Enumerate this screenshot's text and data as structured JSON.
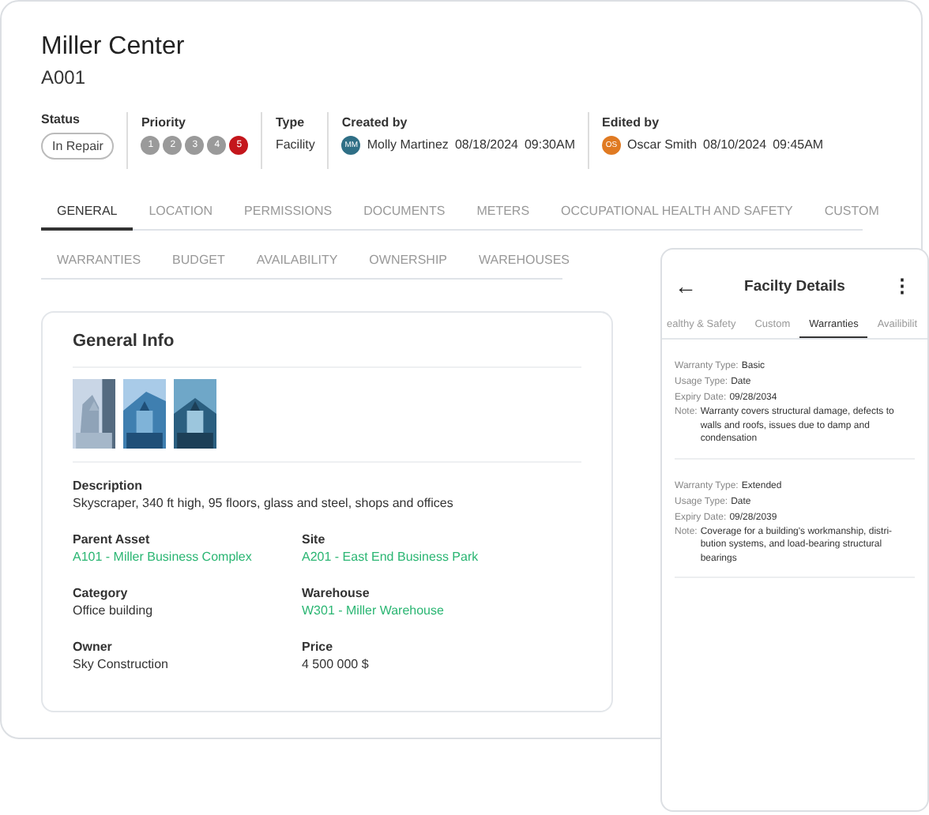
{
  "asset": {
    "title": "Miller Center",
    "code": "A001"
  },
  "meta": {
    "status": {
      "label": "Status",
      "value": "In Repair"
    },
    "priority": {
      "label": "Priority",
      "levels": [
        {
          "text": "1",
          "selected": false
        },
        {
          "text": "2",
          "selected": false
        },
        {
          "text": "3",
          "selected": false
        },
        {
          "text": "4",
          "selected": false
        },
        {
          "text": "5",
          "selected": true
        }
      ]
    },
    "type": {
      "label": "Type",
      "value": "Facility"
    },
    "created": {
      "label": "Created by",
      "initials": "MM",
      "color": "#2f6f86",
      "name": "Molly Martinez",
      "date": "08/18/2024",
      "time": "09:30AM"
    },
    "edited": {
      "label": "Edited by",
      "initials": "OS",
      "color": "#e07a22",
      "name": "Oscar Smith",
      "date": "08/10/2024",
      "time": "09:45AM"
    }
  },
  "tab_rows": [
    [
      {
        "label": "GENERAL",
        "selected": true
      },
      {
        "label": "LOCATION",
        "selected": false
      },
      {
        "label": "PERMISSIONS",
        "selected": false
      },
      {
        "label": "DOCUMENTS",
        "selected": false
      },
      {
        "label": "METERS",
        "selected": false
      },
      {
        "label": "OCCUPATIONAL HEALTH AND SAFETY",
        "selected": false
      },
      {
        "label": "CUSTOM",
        "selected": false
      }
    ],
    [
      {
        "label": "WARRANTIES",
        "selected": false
      },
      {
        "label": "BUDGET",
        "selected": false
      },
      {
        "label": "AVAILABILITY",
        "selected": false
      },
      {
        "label": "OWNERSHIP",
        "selected": false
      },
      {
        "label": "WAREHOUSES",
        "selected": false
      }
    ]
  ],
  "general_info": {
    "title": "General Info",
    "description": {
      "label": "Description",
      "value": "Skyscraper, 340 ft high, 95 floors, glass and steel, shops and offices"
    },
    "fields": [
      {
        "label": "Parent Asset",
        "value": "A101 - Miller Business Complex",
        "kind": "link"
      },
      {
        "label": "Site",
        "value": "A201 - East End Business Park",
        "kind": "link"
      },
      {
        "label": "Category",
        "value": "Office building",
        "kind": "text"
      },
      {
        "label": "Warehouse",
        "value": "W301 - Miller Warehouse",
        "kind": "link"
      },
      {
        "label": "Owner",
        "value": "Sky Construction",
        "kind": "text"
      },
      {
        "label": "Price",
        "value": "4 500 000 $",
        "kind": "text"
      }
    ]
  },
  "mobile": {
    "title": "Facilty Details",
    "back": "←",
    "menu": "⋮",
    "tabs": [
      {
        "label": "ealthy & Safety",
        "selected": false
      },
      {
        "label": "Custom",
        "selected": false
      },
      {
        "label": "Warranties",
        "selected": true
      },
      {
        "label": "Availibilit",
        "selected": false
      }
    ],
    "warranties": [
      {
        "rows": [
          {
            "label": "Warranty Type:",
            "value": "Basic"
          },
          {
            "label": "Usage Type:",
            "value": "Date"
          },
          {
            "label": "Expiry Date:",
            "value": "09/28/2034"
          }
        ],
        "note_label": "Note:",
        "note": "Warranty covers structural damage, defects to walls and roofs, issues due to damp and condensation"
      },
      {
        "rows": [
          {
            "label": "Warranty Type:",
            "value": "Extended"
          },
          {
            "label": "Usage Type:",
            "value": "Date"
          },
          {
            "label": "Expiry Date:",
            "value": "09/28/2039"
          }
        ],
        "note_label": "Note:",
        "note": "Coverage for a building's workmanship, distri-bution systems, and load-bearing structural bearings"
      }
    ]
  }
}
